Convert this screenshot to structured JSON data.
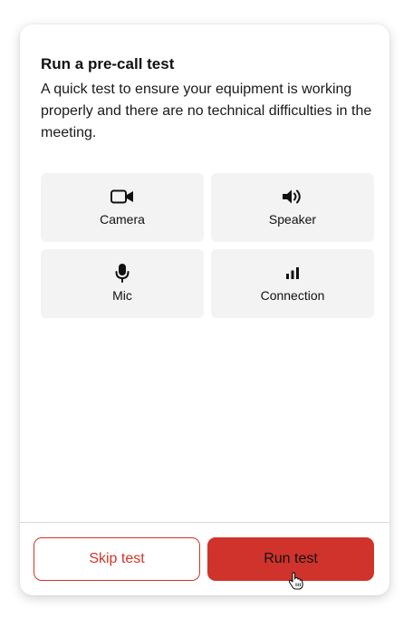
{
  "dialog": {
    "title": "Run a pre-call test",
    "description": "A quick test to ensure your equipment is working properly and there are no technical difficulties in the meeting."
  },
  "tests": [
    {
      "label": "Camera",
      "icon": "camera-icon"
    },
    {
      "label": "Speaker",
      "icon": "speaker-icon"
    },
    {
      "label": "Mic",
      "icon": "microphone-icon"
    },
    {
      "label": "Connection",
      "icon": "signal-bars-icon"
    }
  ],
  "footer": {
    "skip_label": "Skip test",
    "run_label": "Run test"
  },
  "colors": {
    "accent": "#d0332b",
    "tile_bg": "#f3f3f3"
  }
}
